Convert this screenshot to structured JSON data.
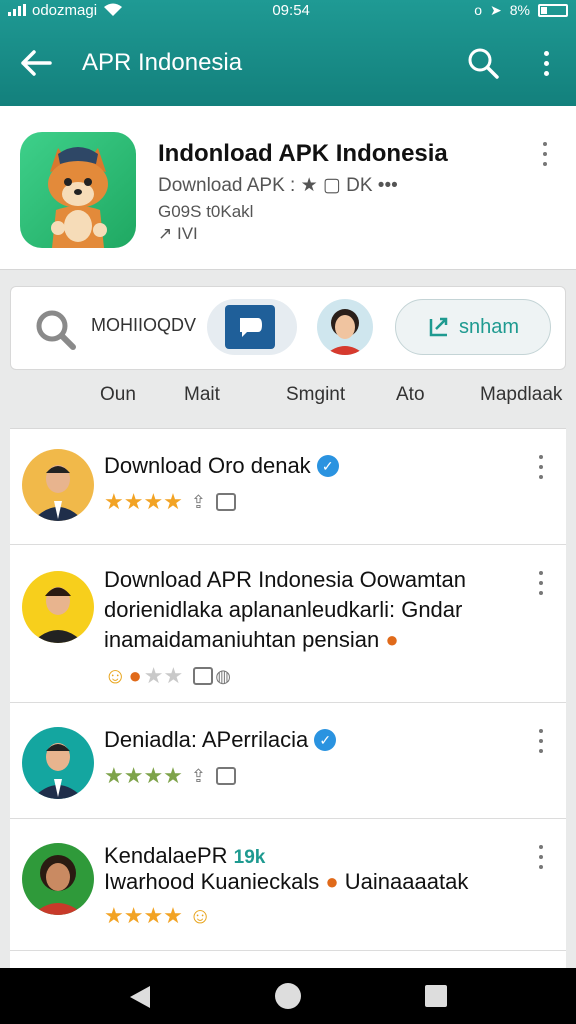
{
  "status": {
    "carrier": "odozmagi",
    "time": "09:54",
    "battery": "8%"
  },
  "appbar": {
    "title": "APR Indonesia"
  },
  "app": {
    "name": "Indonload APK Indonesia",
    "meta": "Download  APK : ★ ▢  DK  •••",
    "sub": "G09S t0Kakl",
    "sub2": "↗ IVI"
  },
  "filter": {
    "text": "MOHIIOQDV",
    "share_label": "snham"
  },
  "tabs": [
    "Oun",
    "Mait",
    "Smgint",
    "Ato",
    "Mapdlaak"
  ],
  "reviews": [
    {
      "title": "Download Oro denak",
      "verified": true,
      "stars_on": 4,
      "stars_off": 0,
      "star_color": "#f2a324"
    },
    {
      "title": "Download APR Indonesia Oowamtan",
      "body1": "dorienidlaka aplananleudkarli: Gndar",
      "body2": "inamaidamaniuhtan pensian",
      "stars_on": 0,
      "stars_off": 2,
      "star_color": "#f2a324"
    },
    {
      "title": "Deniadla: APerrilacia",
      "verified": true,
      "stars_on": 4,
      "stars_off": 0,
      "star_color": "#7ea34a"
    },
    {
      "title": "KendalaePR",
      "title_tag": "19k",
      "body1": "Iwarhood Kuanieckals",
      "body1b": "Uainaaaatak",
      "stars_on": 4,
      "stars_off": 0,
      "star_color": "#f2a324"
    }
  ],
  "icons": [
    "back-arrow-icon",
    "search-icon",
    "more-vert-icon",
    "chat-icon",
    "share-icon",
    "verified-icon",
    "star-icon",
    "home-nav-icon",
    "back-nav-icon",
    "recents-nav-icon"
  ]
}
